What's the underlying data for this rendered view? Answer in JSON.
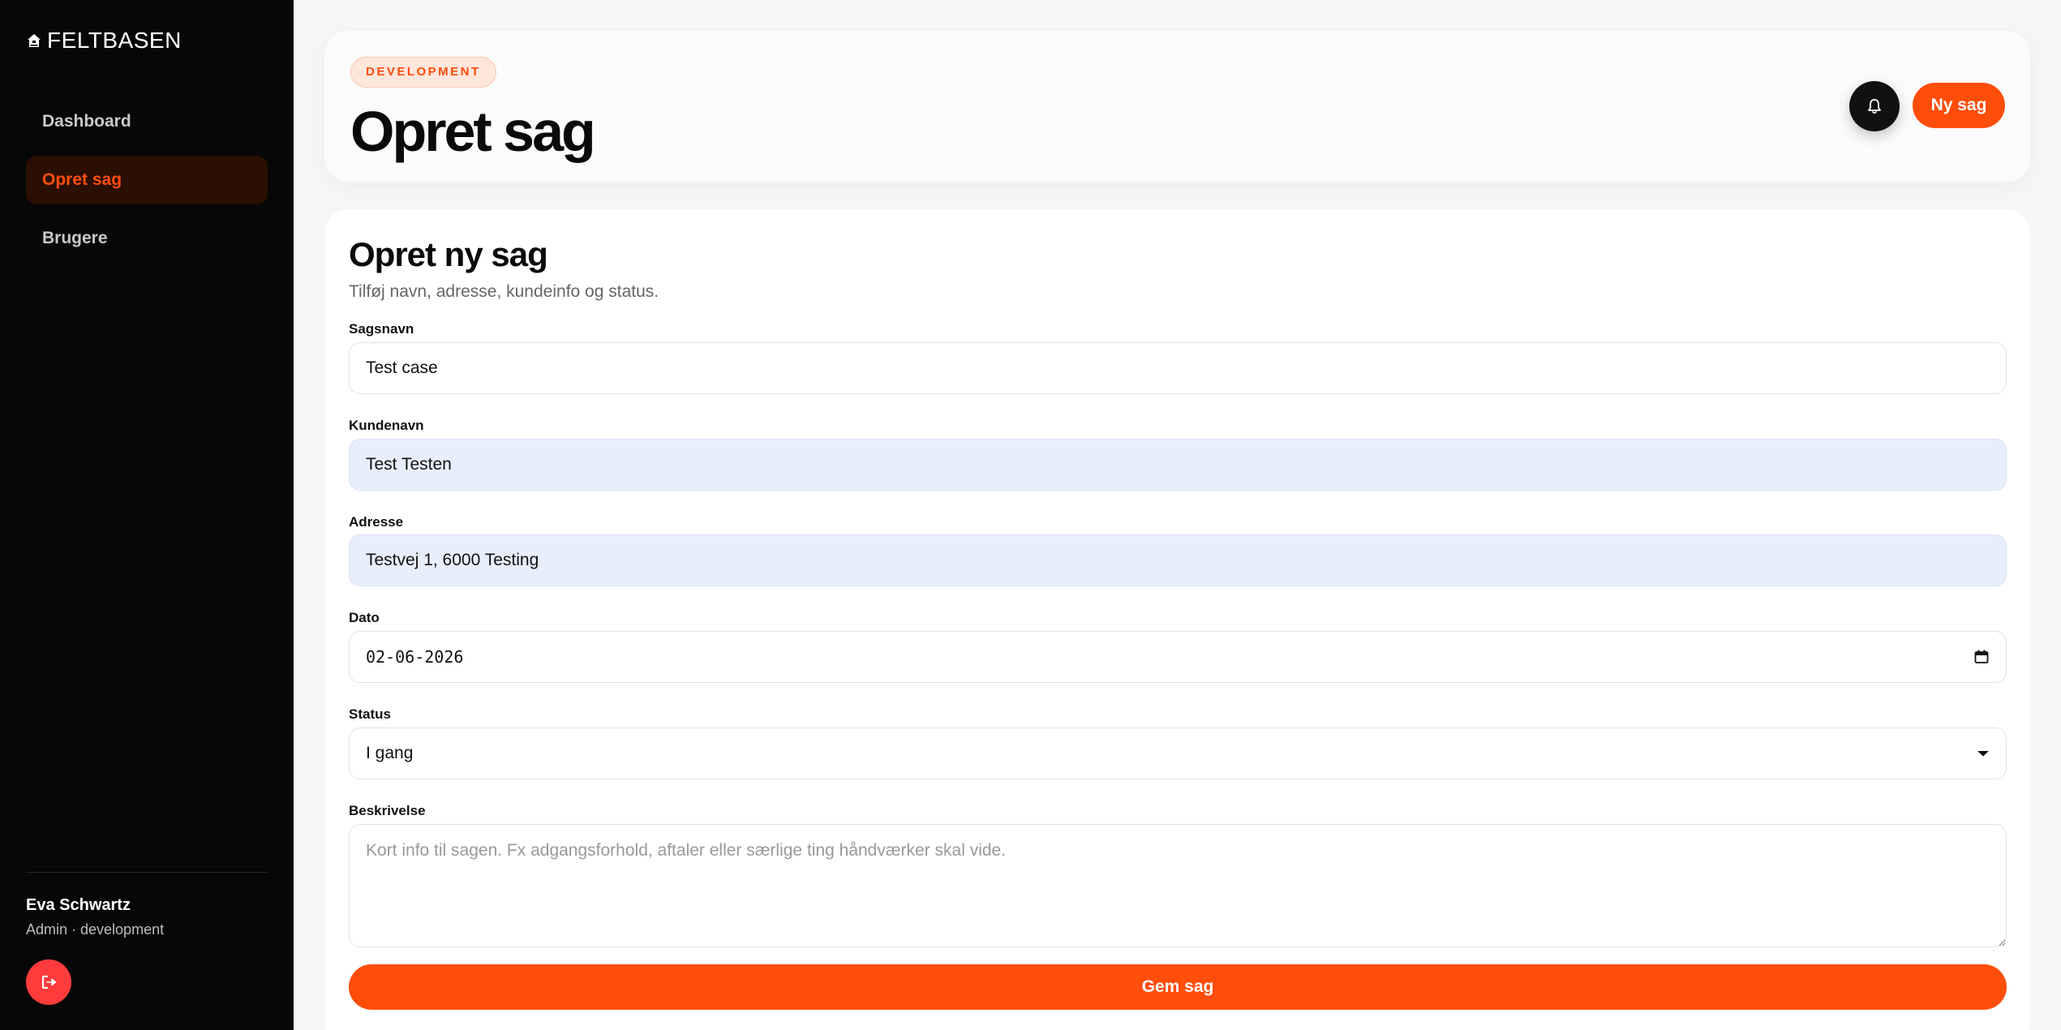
{
  "sidebar": {
    "brand": "FELTBASEN",
    "brand_icon": "house-icon",
    "items": [
      {
        "label": "Dashboard",
        "active": false
      },
      {
        "label": "Opret sag",
        "active": true
      },
      {
        "label": "Brugere",
        "active": false
      }
    ],
    "user": {
      "name": "Eva Schwartz",
      "role": "Admin · development"
    },
    "logout_icon": "logout-icon"
  },
  "header": {
    "environment_badge": "DEVELOPMENT",
    "title": "Opret sag",
    "bell_icon": "bell-icon",
    "new_case_label": "Ny sag"
  },
  "form": {
    "title": "Opret ny sag",
    "subtitle": "Tilføj navn, adresse, kundeinfo og status.",
    "fields": {
      "case_name": {
        "label": "Sagsnavn",
        "value": "Test case"
      },
      "customer_name": {
        "label": "Kundenavn",
        "value": "Test Testen"
      },
      "address": {
        "label": "Adresse",
        "value": "Testvej 1, 6000 Testing"
      },
      "date": {
        "label": "Dato",
        "value": "02-06-2026"
      },
      "status": {
        "label": "Status",
        "value": "I gang"
      },
      "description": {
        "label": "Beskrivelse",
        "value": "",
        "placeholder": "Kort info til sagen. Fx adgangsforhold, aftaler eller særlige ting håndværker skal vide."
      }
    },
    "save_label": "Gem sag"
  },
  "colors": {
    "accent": "#ff4d0a",
    "sidebar_bg": "#070707",
    "page_bg": "#f6f6f6",
    "autofill_bg": "#e8effc",
    "logout": "#ff3b3b"
  }
}
